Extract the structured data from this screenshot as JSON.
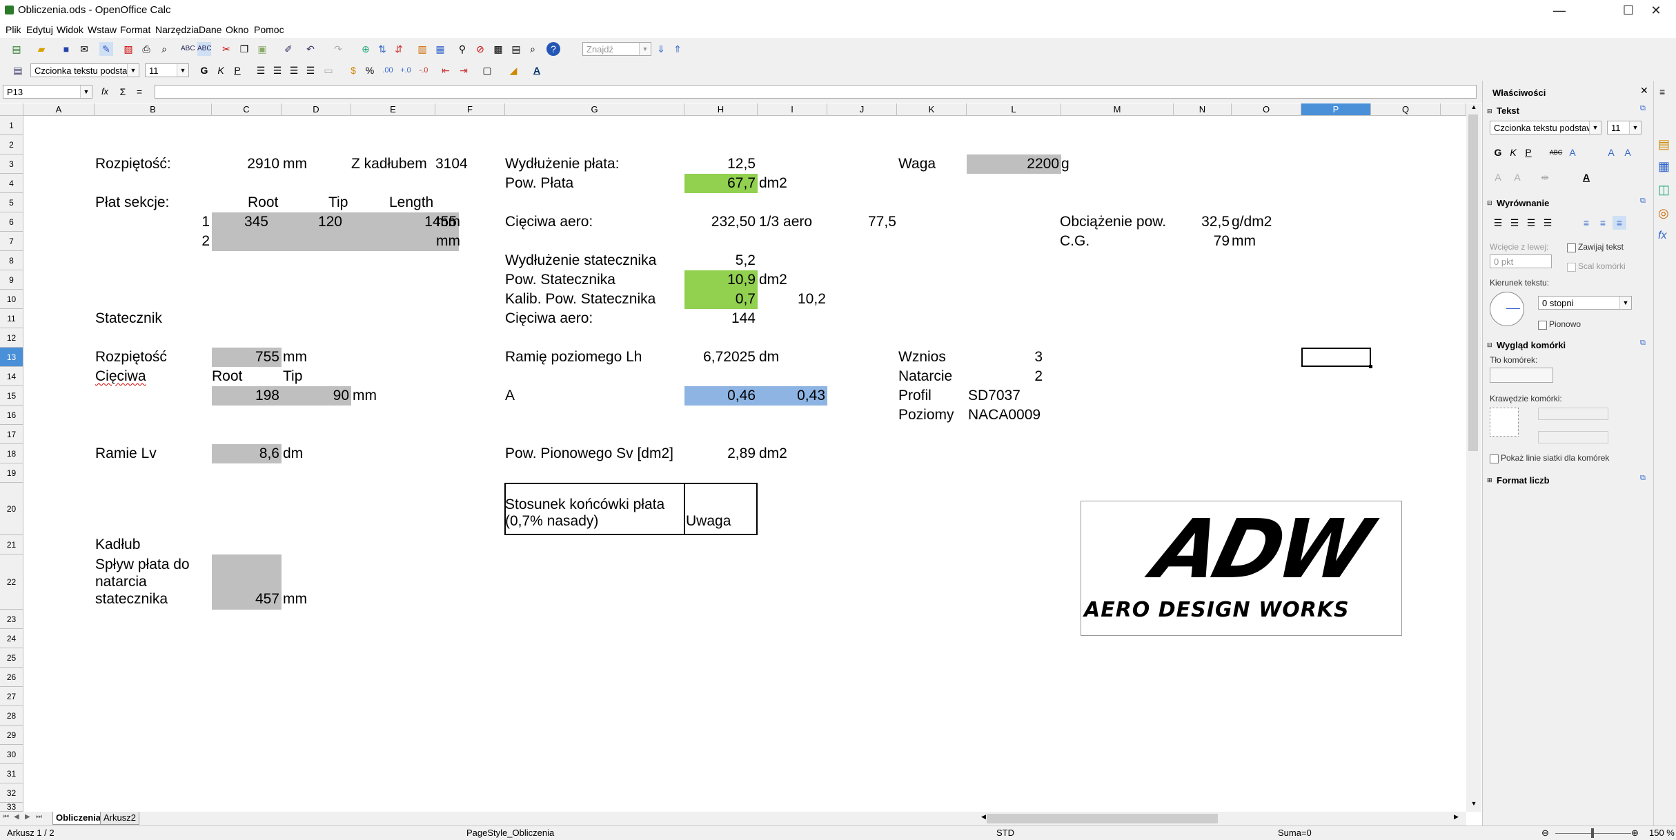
{
  "window": {
    "title": "Obliczenia.ods - OpenOffice Calc",
    "minimize": "—",
    "maximize": "☐",
    "close": "✕"
  },
  "menu": [
    "Plik",
    "Edytuj",
    "Widok",
    "Wstaw",
    "Format",
    "Narzędzia",
    "Dane",
    "Okno",
    "Pomoc"
  ],
  "toolbar": {
    "find_placeholder": "Znajdź",
    "font_name": "Czcionka tekstu podstawo",
    "font_size": "11",
    "bold": "G",
    "italic": "K",
    "underline": "P"
  },
  "formula_bar": {
    "name_box": "P13",
    "fx": "fx",
    "sum": "Σ",
    "equals": "=",
    "content": ""
  },
  "columns": [
    "A",
    "B",
    "C",
    "D",
    "E",
    "F",
    "G",
    "H",
    "I",
    "J",
    "K",
    "L",
    "M",
    "N",
    "O",
    "P",
    "Q"
  ],
  "rows": [
    "1",
    "2",
    "3",
    "4",
    "5",
    "6",
    "7",
    "8",
    "9",
    "10",
    "11",
    "12",
    "13",
    "14",
    "15",
    "16",
    "17",
    "18",
    "19",
    "20",
    "21",
    "22",
    "23",
    "24",
    "25",
    "26",
    "27",
    "28",
    "29",
    "30",
    "31",
    "32",
    "33"
  ],
  "selected_cell": {
    "column": "P",
    "row": "13"
  },
  "cells": {
    "b3": "Rozpiętość:",
    "c3": "2910",
    "d3": "mm",
    "e3": "Z kadłubem",
    "f3": "3104",
    "g3": "Wydłużenie płata:",
    "h3": "12,5",
    "k3": "Waga",
    "l3": "2200",
    "l3u": "g",
    "g4": "Pow. Płata",
    "h4": "67,7",
    "i4": "dm2",
    "b5": "Płat sekcje:",
    "c5": "Root",
    "d5": "Tip",
    "e5": "Length",
    "b6": "1",
    "c6": "345",
    "d6": "120",
    "e6": "1455",
    "f6": "mm",
    "g6": "Cięciwa aero:",
    "h6": "232,50",
    "i6": "1/3 aero",
    "j6": "77,5",
    "m6": "Obciążenie pow.",
    "n6": "32,5",
    "o6": "g/dm2",
    "b7": "2",
    "f7": "mm",
    "m7": "C.G.",
    "n7": "79",
    "o7": "mm",
    "g8": "Wydłużenie statecznika",
    "h8": "5,2",
    "g9": "Pow. Statecznika",
    "h9": "10,9",
    "i9": "dm2",
    "g10": "Kalib. Pow. Statecznika",
    "h10": "0,7",
    "j10": "10,2",
    "b11": "Statecznik",
    "g11": "Cięciwa aero:",
    "h11": "144",
    "b13": "Rozpiętość",
    "c13": "755",
    "d13": "mm",
    "g13": "Ramię poziomego Lh",
    "h13": "6,72025",
    "i13": "dm",
    "k13": "Wznios",
    "l13": "3",
    "b14": "Cięciwa",
    "c14": "Root",
    "d14": "Tip",
    "k14": "Natarcie",
    "l14": "2",
    "c15": "198",
    "d15": "90",
    "e15": "mm",
    "g15": "A",
    "h15": "0,46",
    "i15": "0,43",
    "k15": "Profil",
    "l15": "SD7037",
    "k16": "Poziomy",
    "l16": "NACA0009",
    "b18": "Ramie Lv",
    "c18": "8,6",
    "d18": "dm",
    "g18": "Pow. Pionowego Sv [dm2]",
    "h18": "2,89",
    "i18": "dm2",
    "g20a": "Stosunek końcówki płata",
    "g20b": "(0,7% nasady)",
    "h20": "Uwaga",
    "b21": "Kadłub",
    "b22a": "Spływ płata do",
    "b22b": "natarcia",
    "b22c": "statecznika",
    "c22": "457",
    "d22": "mm"
  },
  "logo": {
    "main": "ADW",
    "sub": "AERO DESIGN WORKS"
  },
  "sidebar": {
    "title": "Właściwości",
    "text_section": "Tekst",
    "font_name": "Czcionka tekstu podstawo",
    "font_size": "11",
    "align_section": "Wyrównanie",
    "indent_label": "Wcięcie z lewej:",
    "indent_value": "0 pkt",
    "wrap_text": "Zawijaj tekst",
    "merge_cells": "Scal komórki",
    "direction_label": "Kierunek tekstu:",
    "direction_value": "0 stopni",
    "vertical": "Pionowo",
    "look_section": "Wygląd komórki",
    "bg_label": "Tło komórek:",
    "borders_label": "Krawędzie komórki:",
    "gridlines": "Pokaż linie siatki dla komórek",
    "number_format": "Format liczb"
  },
  "sheets": [
    {
      "name": "Obliczenia",
      "active": true
    },
    {
      "name": "Arkusz2",
      "active": false
    }
  ],
  "status": {
    "sheet": "Arkusz 1 / 2",
    "page_style": "PageStyle_Obliczenia",
    "mode": "STD",
    "sum": "Suma=0",
    "zoom": "150 %"
  },
  "colors": {
    "grey_fill": "#bfbfbf",
    "green_fill": "#92d050",
    "blue_fill": "#8db4e2",
    "selection": "#4a90d9"
  }
}
